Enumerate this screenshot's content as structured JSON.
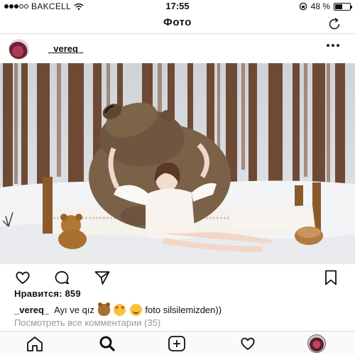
{
  "status_bar": {
    "carrier": "BAKCELL",
    "time": "17:55",
    "battery_percent": "48 %",
    "signal_bars_filled": 3,
    "signal_bars_total": 5,
    "battery_level": 0.48
  },
  "nav": {
    "title": "Фото",
    "refresh_icon": "refresh-icon"
  },
  "post": {
    "username": "_vereq_",
    "likes_text": "Нравится: 859",
    "caption_user": "_vereq_",
    "caption_text_1": "Ayı ve qız",
    "caption_text_2": "foto silsilemizden))",
    "caption_emojis": [
      "bear-face-emoji",
      "heart-eyes-emoji",
      "smiling-face-emoji"
    ],
    "view_comments": "Посмотреть все комментарии (35)"
  },
  "actions": [
    "heart-icon",
    "comment-icon",
    "share-icon",
    "bookmark-icon"
  ],
  "tabs": [
    "home-icon",
    "search-icon",
    "add-icon",
    "heart-icon",
    "profile-avatar"
  ],
  "colors": {
    "divider": "#dbdbdb",
    "muted_text": "#999999",
    "snow": "#f3f4f6",
    "bear_fur": "#7a6148"
  }
}
